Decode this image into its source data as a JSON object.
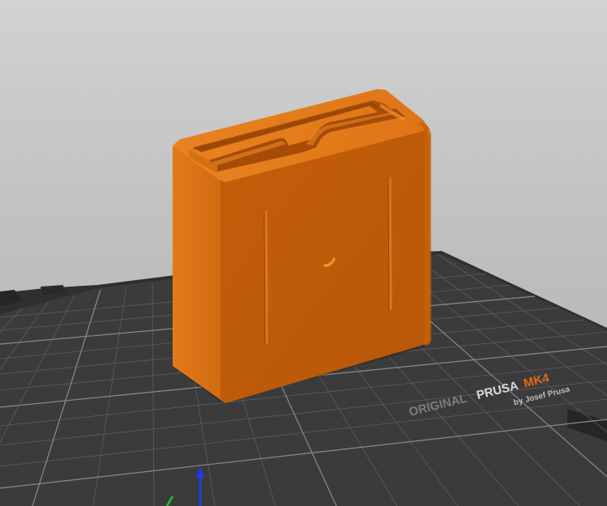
{
  "viewer": {
    "bed_brand": {
      "prefix": "ORIGINAL",
      "name": "PRUSA",
      "model": "MK4",
      "byline": "by Josef Prusa"
    },
    "colors": {
      "background": "#c2c2c2",
      "bed": "#3a3a3a",
      "bed_grid": "#6b6b6b",
      "model": "#e07415",
      "axis_z": "#1a3cff",
      "axis_x": "#e03020",
      "axis_y": "#20c030"
    },
    "object": {
      "name": "box-with-slots",
      "selected": false
    }
  }
}
